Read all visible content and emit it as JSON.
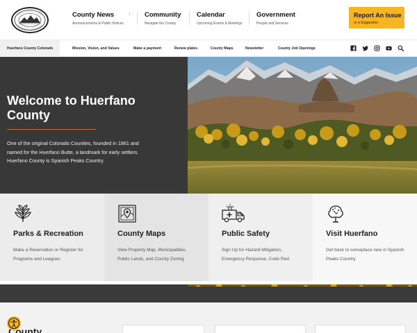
{
  "brand": {
    "logo_alt": "Huerfano County Colorado seal",
    "accent": "#f6b523",
    "dark": "#383838",
    "rule": "#c86a3a"
  },
  "nav": [
    {
      "title": "County News",
      "sub": "Announcements & Public Notices",
      "icon": "chevron-down-icon"
    },
    {
      "title": "Community",
      "sub": "Navigate the County",
      "icon": "chevron-down-icon"
    },
    {
      "title": "Calendar",
      "sub": "Upcoming Events & Meetings",
      "icon": "chevron-down-icon"
    },
    {
      "title": "Government",
      "sub": "People and Services",
      "icon": "chevron-down-icon"
    }
  ],
  "report": {
    "title": "Report An Issue",
    "sub": "or a Suggestion"
  },
  "subnav": {
    "home": "Huerfano County Colorado",
    "links": [
      "Mission, Vision, and Values",
      "Make a payment",
      "Renew plates",
      "County Maps",
      "Newsletter",
      "County Job Openings"
    ],
    "social": [
      "facebook-icon",
      "twitter-icon",
      "instagram-icon",
      "youtube-icon",
      "search-icon"
    ]
  },
  "hero": {
    "title": "Welcome to Huerfano County",
    "text": "One of the original Colorado Counties, founded in 1861 and named for the Huerfano Butte, a landmark for early settlers. Huerfano County is Spanish Peaks Country."
  },
  "cards": [
    {
      "title": "Parks & Recreation",
      "desc": "Make a Reservation or Register for Programs and Leagues",
      "icon": "wheat-icon",
      "bg": "#ececec"
    },
    {
      "title": "County Maps",
      "desc": "View Property Map, Municipalities, Public Lands, and County Zoning",
      "icon": "map-icon",
      "bg": "#e4e4e4"
    },
    {
      "title": "Public Safety",
      "desc": "Sign Up for Hazard Mitigation, Emergency Response, Code Red",
      "icon": "ambulance-icon",
      "bg": "#efefef"
    },
    {
      "title": "Visit Huerfano",
      "desc": "Get back to someplace new in Spanish Peaks Country",
      "icon": "tree-icon",
      "bg": "#f7f7f7"
    }
  ],
  "bottom": {
    "title": "County"
  }
}
